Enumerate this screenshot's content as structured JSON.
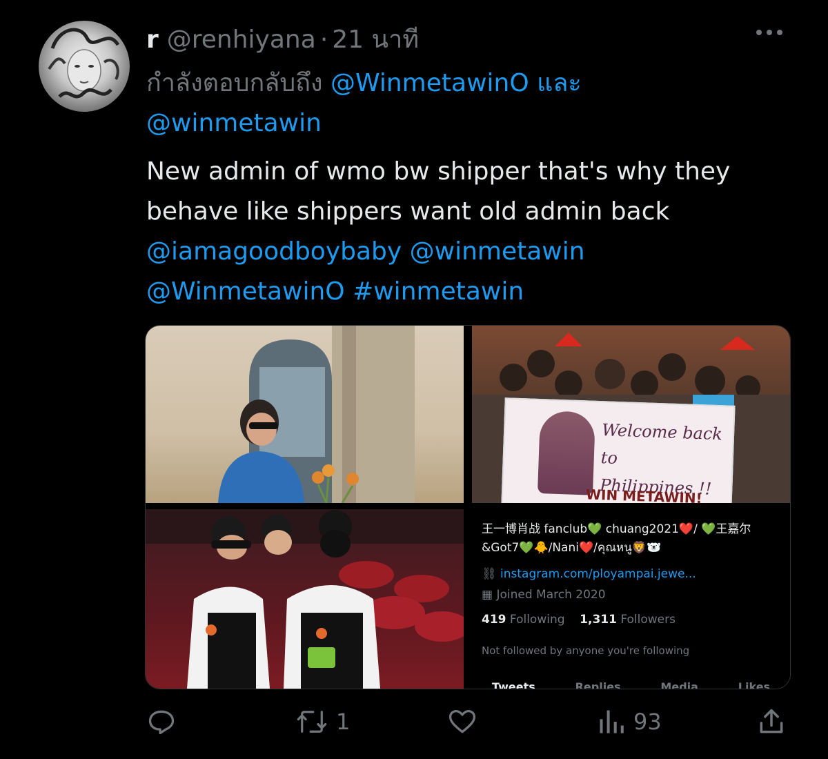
{
  "tweet": {
    "display_name": "r",
    "handle": "@renhiyana",
    "separator": "·",
    "time": "21 นาที",
    "replying_prefix": "กำลังตอบกลับถึง",
    "replying_user1": "@WinmetawinO",
    "replying_and": "และ",
    "replying_user2": "@winmetawin",
    "text_line1": "New admin of wmo bw shipper that's why they",
    "text_line2": "behave like shippers want old admin back",
    "mention1": "@iamagoodboybaby",
    "mention2": "@winmetawin",
    "mention3": "@WinmetawinO",
    "hashtag": "#winmetawin"
  },
  "media": {
    "banner_line1": "Welcome back to",
    "banner_line2": "Philippines !!",
    "banner_name": "WIN METAWIN!",
    "profile": {
      "line_fanclub": "王一博肖战 fanclub💚 chuang2021❤️/ 💚王嘉尔",
      "line_got7": "&Got7💚🐥/Nani❤️/คุณหนู🦁🐻‍❄️",
      "link": "instagram.com/ployampai.jewe...",
      "joined": "Joined March 2020",
      "following_count": "419",
      "following_label": "Following",
      "followers_count": "1,311",
      "followers_label": "Followers",
      "not_followed": "Not followed by anyone you're following",
      "tabs": [
        "Tweets",
        "Replies",
        "Media",
        "Likes"
      ]
    }
  },
  "actions": {
    "reply_count": "",
    "retweet_count": "1",
    "like_count": "",
    "views_count": "93"
  },
  "colors": {
    "background": "#000000",
    "text": "#e7e9ea",
    "muted": "#71767b",
    "link": "#1d9bf0"
  }
}
